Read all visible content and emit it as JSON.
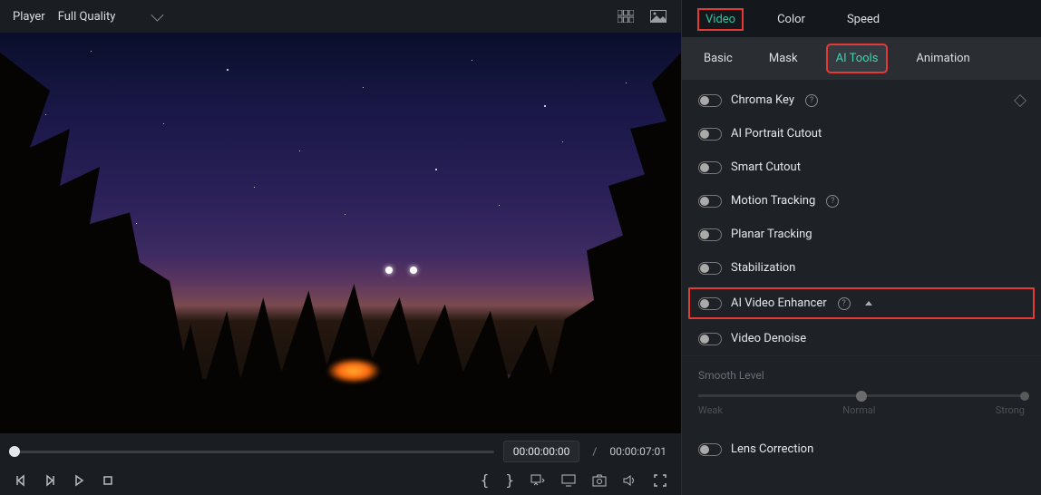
{
  "player": {
    "label": "Player",
    "quality": "Full Quality",
    "current_time": "00:00:00:00",
    "duration": "00:00:07:01"
  },
  "top_tabs": {
    "video": "Video",
    "color": "Color",
    "speed": "Speed",
    "active": "Video"
  },
  "sub_tabs": {
    "basic": "Basic",
    "mask": "Mask",
    "ai_tools": "AI Tools",
    "animation": "Animation",
    "active": "AI Tools"
  },
  "tools": {
    "chroma_key": "Chroma Key",
    "ai_portrait_cutout": "AI Portrait Cutout",
    "smart_cutout": "Smart Cutout",
    "motion_tracking": "Motion Tracking",
    "planar_tracking": "Planar Tracking",
    "stabilization": "Stabilization",
    "ai_video_enhancer": "AI Video Enhancer",
    "video_denoise": "Video Denoise",
    "lens_correction": "Lens Correction"
  },
  "smooth": {
    "label": "Smooth Level",
    "weak": "Weak",
    "normal": "Normal",
    "strong": "Strong"
  }
}
